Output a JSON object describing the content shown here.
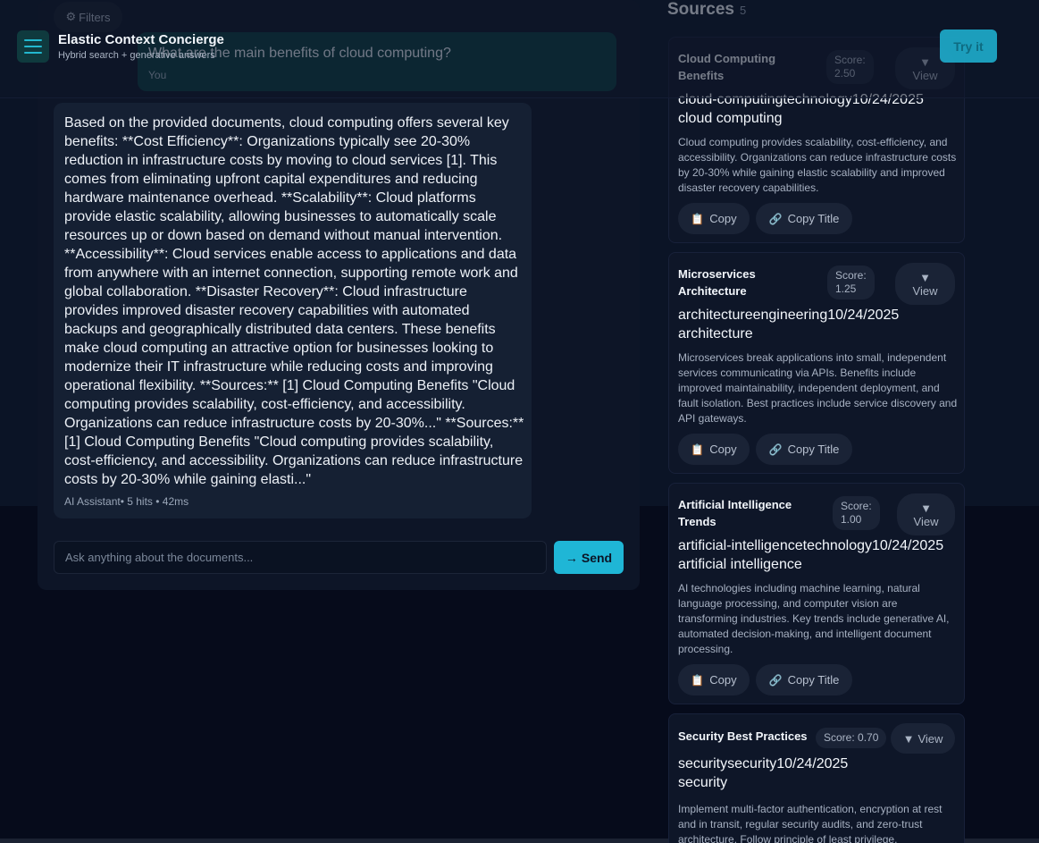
{
  "header": {
    "title": "Elastic Context Concierge",
    "subtitle": "Hybrid search + generative answers",
    "try_label": "Try it"
  },
  "filters": {
    "icon": "gear-icon",
    "label": "Filters"
  },
  "chat": {
    "user_question": "What are the main benefits of cloud computing?",
    "user_label": "You",
    "answer": "Based on the provided documents, cloud computing offers several key benefits: **Cost Efficiency**: Organizations typically see 20-30% reduction in infrastructure costs by moving to cloud services [1]. This comes from eliminating upfront capital expenditures and reducing hardware maintenance overhead. **Scalability**: Cloud platforms provide elastic scalability, allowing businesses to automatically scale resources up or down based on demand without manual intervention. **Accessibility**: Cloud services enable access to applications and data from anywhere with an internet connection, supporting remote work and global collaboration. **Disaster Recovery**: Cloud infrastructure provides improved disaster recovery capabilities with automated backups and geographically distributed data centers. These benefits make cloud computing an attractive option for businesses looking to modernize their IT infrastructure while reducing costs and improving operational flexibility. **Sources:** [1] Cloud Computing Benefits \"Cloud computing provides scalability, cost-efficiency, and accessibility. Organizations can reduce infrastructure costs by 20-30%...\" **Sources:** [1] Cloud Computing Benefits \"Cloud computing provides scalability, cost-efficiency, and accessibility. Organizations can reduce infrastructure costs by 20-30% while gaining elasti...\"",
    "answer_meta": "AI Assistant• 5 hits • 42ms",
    "input_placeholder": "Ask anything about the documents...",
    "input_value": "",
    "send_label": "Send",
    "send_arrow": "→"
  },
  "sources": {
    "title": "Sources",
    "count": "5",
    "copy_label": "Copy",
    "copy_title_label": "Copy Title",
    "view_label": "View",
    "view_arrow": "▼",
    "items": [
      {
        "title_line1": "Cloud Computing",
        "title_line2": "Benefits",
        "score_line1": "Score:",
        "score_line2": "2.50",
        "meta_line1": "cloud-computingtechnology10/24/2025",
        "meta_line2": "cloud computing",
        "description": "Cloud computing provides scalability, cost-efficiency, and accessibility. Organizations can reduce infrastructure costs by 20-30% while gaining elastic scalability and improved disaster recovery capabilities."
      },
      {
        "title_line1": "Microservices",
        "title_line2": "Architecture",
        "score_line1": "Score:",
        "score_line2": "1.25",
        "meta_line1": "architectureengineering10/24/2025",
        "meta_line2": "architecture",
        "description": "Microservices break applications into small, independent services communicating via APIs. Benefits include improved maintainability, independent deployment, and fault isolation. Best practices include service discovery and API gateways."
      },
      {
        "title_line1": "Artificial Intelligence",
        "title_line2": "Trends",
        "score_line1": "Score:",
        "score_line2": "1.00",
        "meta_line1": "artificial-intelligencetechnology10/24/2025",
        "meta_line2": "artificial intelligence",
        "description": "AI technologies including machine learning, natural language processing, and computer vision are transforming industries. Key trends include generative AI, automated decision-making, and intelligent document processing."
      },
      {
        "title": "Security Best Practices",
        "score": "Score: 0.70",
        "meta_line1": "securitysecurity10/24/2025",
        "meta_line2": "security",
        "description": "Implement multi-factor authentication, encryption at rest and in transit, regular security audits, and zero-trust architecture. Follow principle of least privilege."
      }
    ]
  },
  "colors": {
    "accent": "#1fb6d6",
    "background": "#060b1b",
    "panel": "#0d1527",
    "user_bubble": "#0a3b3f"
  }
}
